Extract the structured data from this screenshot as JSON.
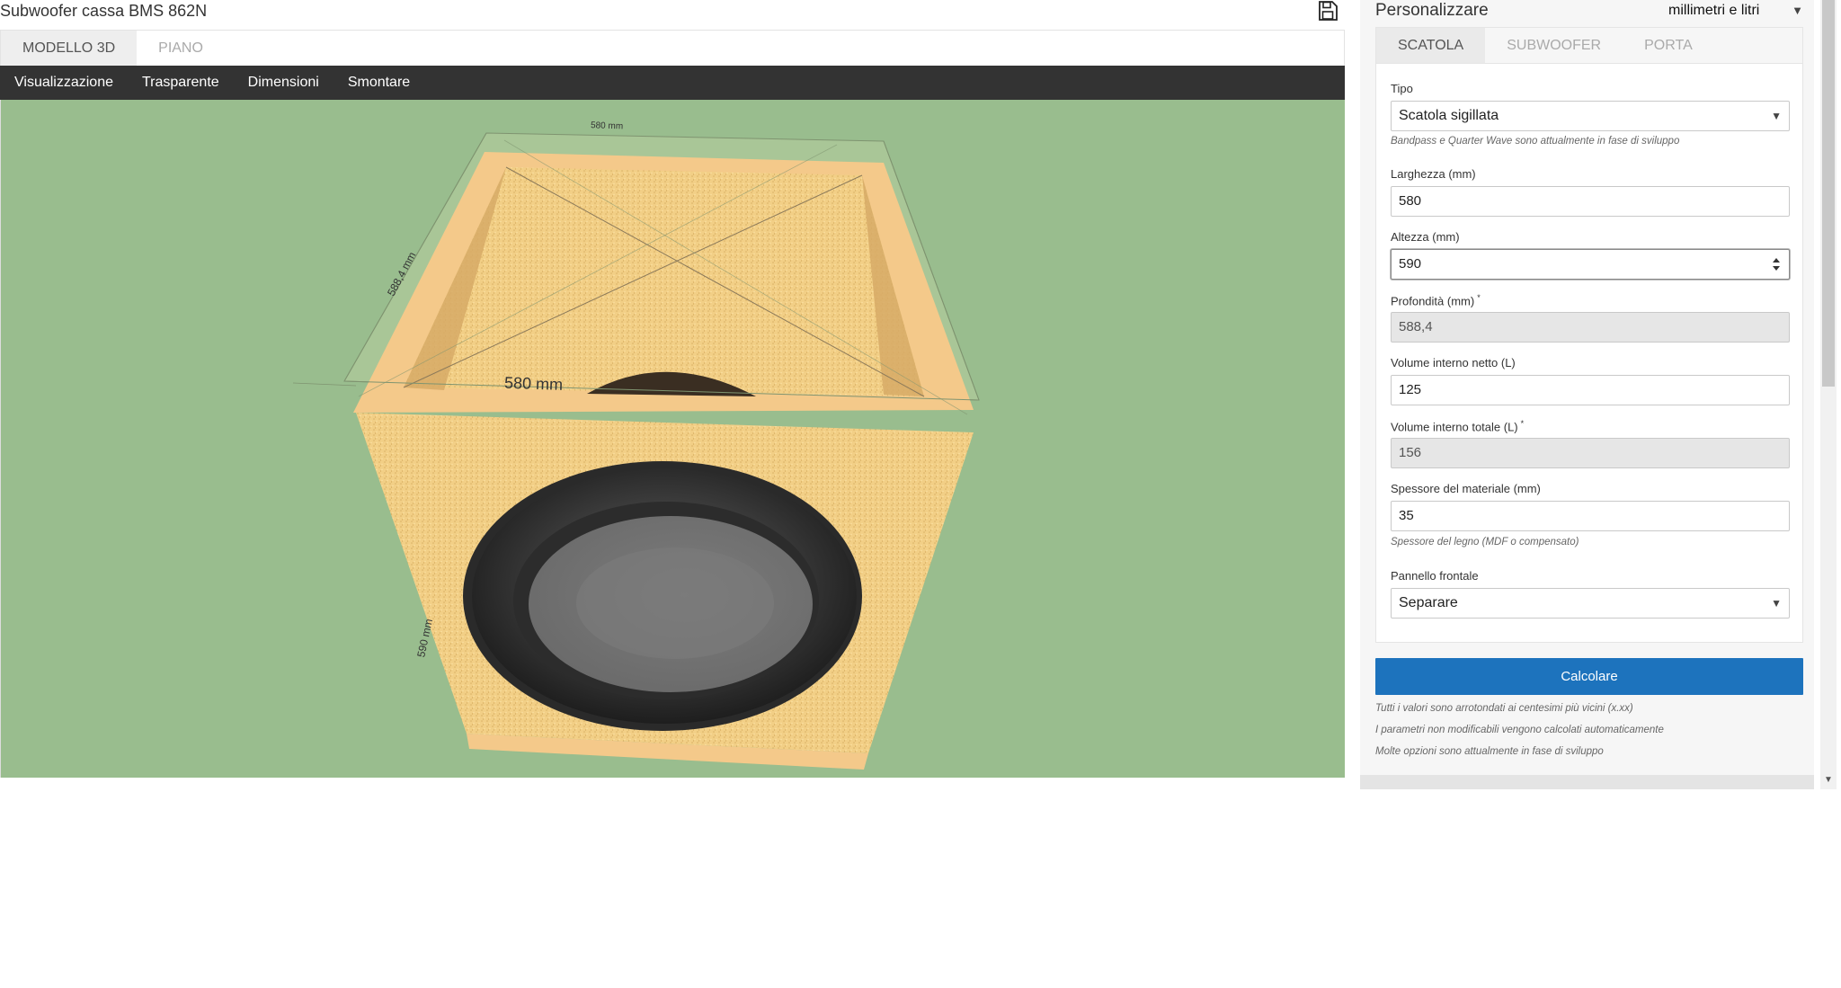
{
  "app": {
    "title": "Subwoofer cassa BMS 862N"
  },
  "view_tabs": [
    {
      "label": "MODELLO 3D",
      "active": true
    },
    {
      "label": "PIANO",
      "active": false
    }
  ],
  "toolbar": {
    "items": [
      "Visualizzazione",
      "Trasparente",
      "Dimensioni",
      "Smontare"
    ]
  },
  "viewport": {
    "dimension_labels": {
      "top_width": "580 mm",
      "front_width": "580 mm",
      "depth": "588,4 mm",
      "height": "590 mm"
    }
  },
  "panel": {
    "title": "Personalizzare",
    "units": "millimetri e litri",
    "tabs": [
      {
        "label": "SCATOLA",
        "active": true
      },
      {
        "label": "SUBWOOFER",
        "active": false
      },
      {
        "label": "PORTA",
        "active": false
      }
    ],
    "fields": {
      "tipo": {
        "label": "Tipo",
        "value": "Scatola sigillata",
        "hint": "Bandpass e Quarter Wave sono attualmente in fase di sviluppo"
      },
      "larghezza": {
        "label": "Larghezza (mm)",
        "value": "580"
      },
      "altezza": {
        "label": "Altezza (mm)",
        "value": "590"
      },
      "profondita": {
        "label": "Profondità (mm)",
        "marker": "*",
        "value": "588,4"
      },
      "volume_netto": {
        "label": "Volume interno netto (L)",
        "value": "125"
      },
      "volume_totale": {
        "label": "Volume interno totale (L)",
        "marker": "*",
        "value": "156"
      },
      "spessore": {
        "label": "Spessore del materiale (mm)",
        "value": "35",
        "hint": "Spessore del legno (MDF o compensato)"
      },
      "pannello": {
        "label": "Pannello frontale",
        "value": "Separare"
      }
    },
    "calculate_label": "Calcolare",
    "notes": [
      "Tutti i valori sono arrotondati ai centesimi più vicini (x.xx)",
      "I parametri non modificabili vengono calcolati automaticamente",
      "Molte opzioni sono attualmente in fase di sviluppo"
    ]
  },
  "colors": {
    "viewport_bg": "#99bd8e",
    "toolbar_bg": "#333333",
    "accent": "#1d73bd"
  }
}
